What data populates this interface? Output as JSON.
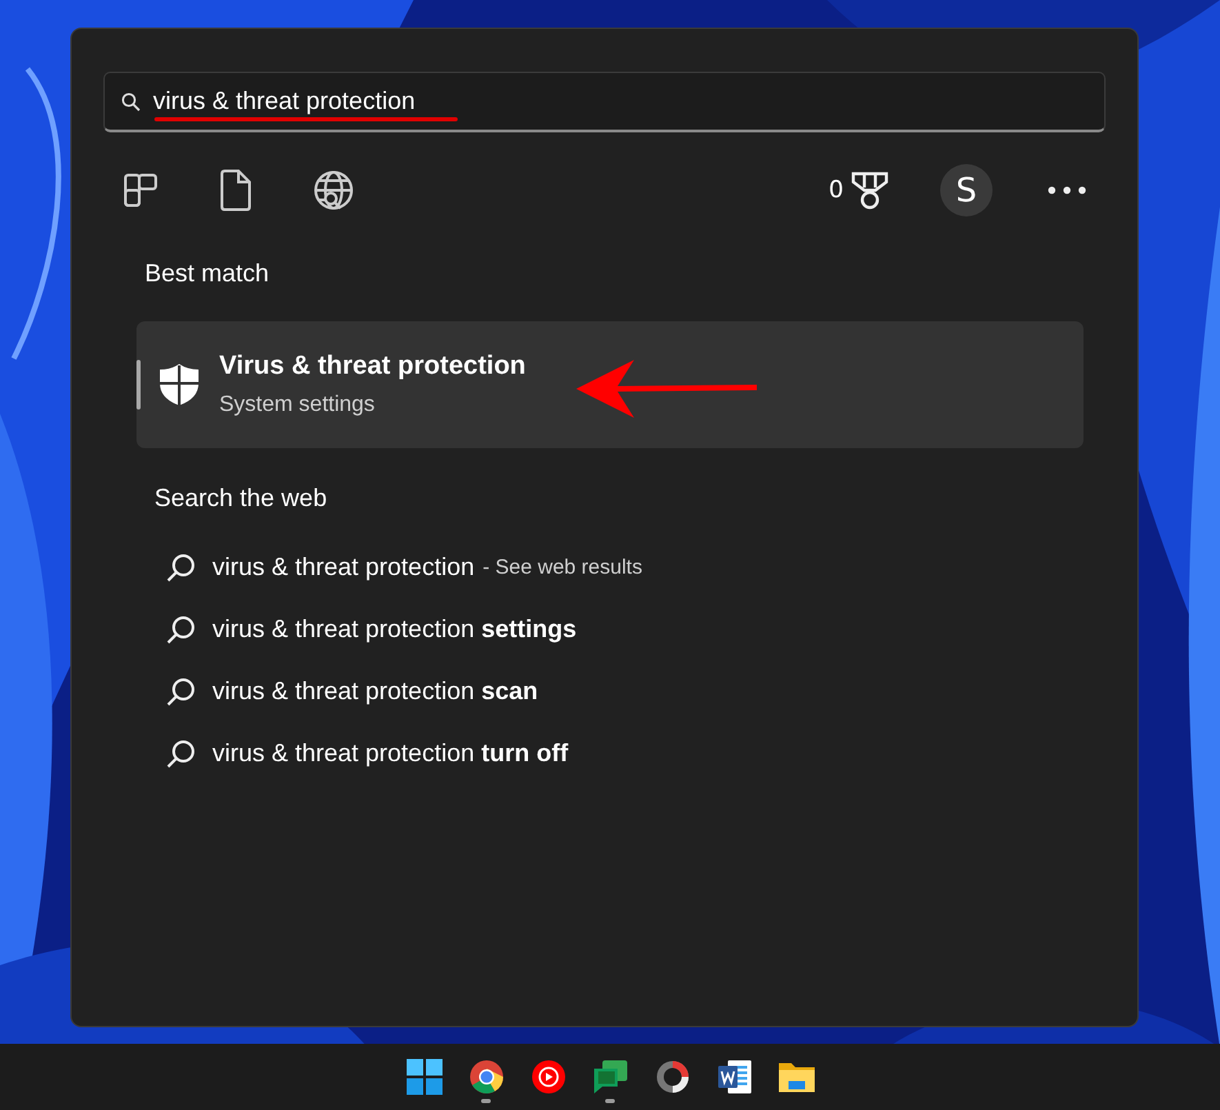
{
  "search": {
    "value": "virus & threat protection"
  },
  "toolbar": {
    "points": "0",
    "avatar": "S"
  },
  "best_match": {
    "heading": "Best match",
    "title": "Virus & threat protection",
    "subtitle": "System settings",
    "selected": true
  },
  "web": {
    "heading": "Search the web",
    "items": [
      {
        "text": "virus & threat protection",
        "hint": "- See web results"
      },
      {
        "text": "virus & threat protection **settings**"
      },
      {
        "text": "virus & threat protection **scan**"
      },
      {
        "text": "virus & threat protection **turn off**"
      }
    ]
  },
  "taskbar": {
    "apps": [
      {
        "kind": "start",
        "running": false
      },
      {
        "kind": "browser",
        "running": true
      },
      {
        "kind": "music",
        "running": false
      },
      {
        "kind": "chat",
        "running": true
      },
      {
        "kind": "recorder",
        "running": false
      },
      {
        "kind": "word",
        "running": false
      },
      {
        "kind": "folder",
        "running": false
      }
    ]
  }
}
